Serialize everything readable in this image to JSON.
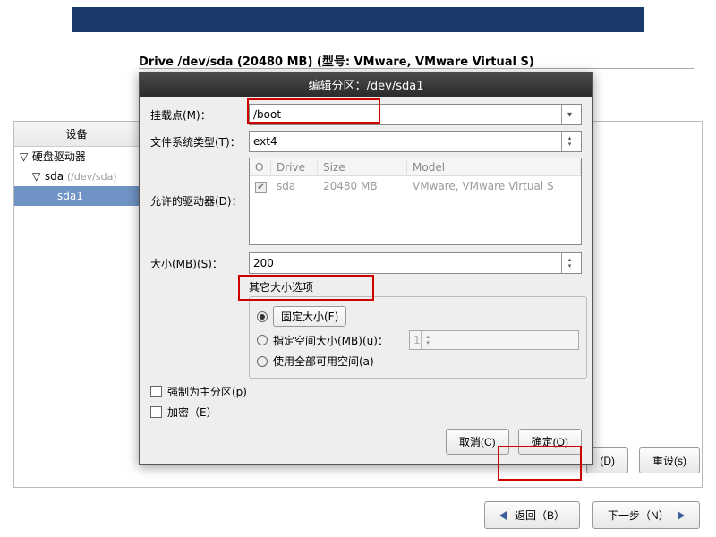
{
  "topbar": {},
  "drive_header": "Drive /dev/sda (20480 MB) (型号: VMware, VMware Virtual S)",
  "device_panel": {
    "header": "设备",
    "tree": {
      "root": "硬盘驱动器",
      "disk": "sda",
      "disk_path": "(/dev/sda)",
      "partition": "sda1"
    }
  },
  "dialog": {
    "title": "编辑分区：/dev/sda1",
    "labels": {
      "mount": "挂载点(M)：",
      "fstype": "文件系统类型(T)：",
      "allowed": "允许的驱动器(D)：",
      "size": "大小(MB)(S)：",
      "other_size": "其它大小选项",
      "fixed": "固定大小(F)",
      "fill_to": "指定空间大小(MB)(u)：",
      "fill_all": "使用全部可用空间(a)",
      "force_primary": "强制为主分区(p)",
      "encrypt": "加密（E）"
    },
    "values": {
      "mount": "/boot",
      "fstype": "ext4",
      "size": "200",
      "fill_to_value": "1"
    },
    "drives_table": {
      "headers": {
        "chk": "O",
        "drive": "Drive",
        "size": "Size",
        "model": "Model"
      },
      "row": {
        "checked": true,
        "drive": "sda",
        "size": "20480 MB",
        "model": "VMware, VMware Virtual S"
      }
    },
    "buttons": {
      "cancel": "取消(C)",
      "ok": "确定(O)"
    }
  },
  "footer": {
    "create": "(D)",
    "reset": "重设(s)",
    "back": "返回（B）",
    "next": "下一步（N）"
  }
}
